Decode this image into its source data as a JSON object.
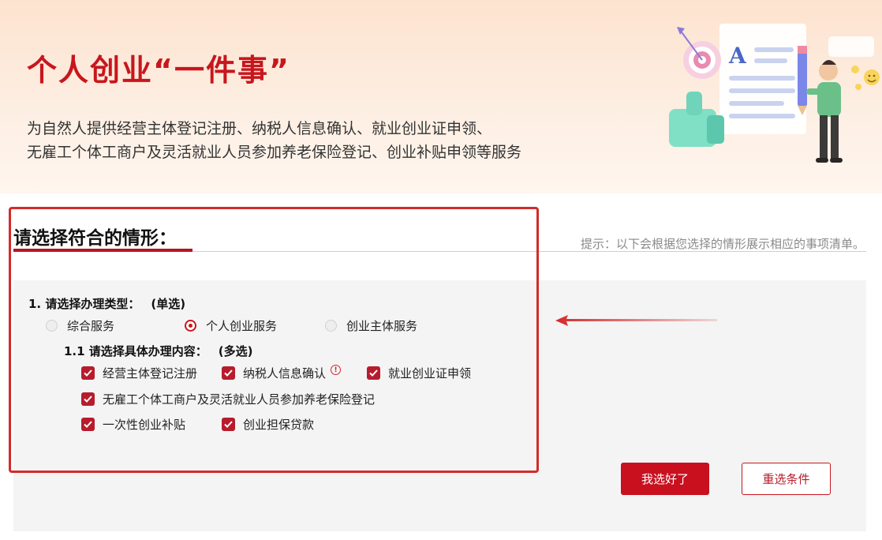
{
  "hero": {
    "title": "个人创业“一件事”",
    "description_line1": "为自然人提供经营主体登记注册、纳税人信息确认、就业创业证申领、",
    "description_line2": "无雇工个体工商户及灵活就业人员参加养老保险登记、创业补贴申领等服务",
    "illustration_icons": [
      "target-icon",
      "thumbs-up-icon",
      "document-icon",
      "pen-icon",
      "person-icon",
      "smiley-icon"
    ]
  },
  "section": {
    "title": "请选择符合的情形：",
    "hint": "提示：以下会根据您选择的情形展示相应的事项清单。"
  },
  "question1": {
    "label": "1. 请选择办理类型：",
    "tag": "(单选)",
    "options": [
      {
        "label": "综合服务",
        "checked": false
      },
      {
        "label": "个人创业服务",
        "checked": true
      },
      {
        "label": "创业主体服务",
        "checked": false
      }
    ]
  },
  "question1_1": {
    "label": "1.1 请选择具体办理内容：",
    "tag": "(多选)",
    "options": [
      {
        "label": "经营主体登记注册",
        "checked": true
      },
      {
        "label": "纳税人信息确认",
        "checked": true,
        "icon": "info-icon"
      },
      {
        "label": "就业创业证申领",
        "checked": true
      },
      {
        "label": "无雇工个体工商户及灵活就业人员参加养老保险登记",
        "checked": true
      },
      {
        "label": "一次性创业补贴",
        "checked": true
      },
      {
        "label": "创业担保贷款",
        "checked": true
      }
    ]
  },
  "buttons": {
    "confirm": "我选好了",
    "reset": "重选条件"
  },
  "colors": {
    "brand_red": "#c8161d",
    "checkbox_red": "#b71c2c",
    "highlight_red": "#d42a2a",
    "panel_bg": "#f4f4f5"
  }
}
